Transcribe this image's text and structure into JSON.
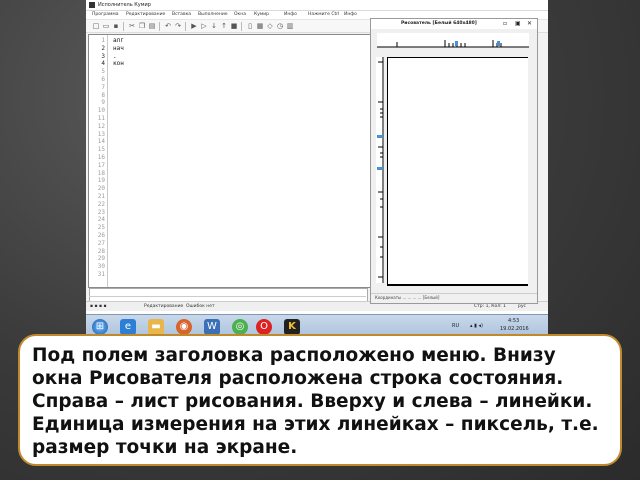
{
  "app": {
    "title": "Исполнитель Кумир",
    "menu": [
      "Программа",
      "Редактирование",
      "Вставка",
      "Выполнение",
      "Окна",
      "Кумир",
      "Инфо",
      "Нажмите Ctrl",
      "Инфо"
    ]
  },
  "editor": {
    "line_numbers": [
      "1",
      "2",
      "3",
      "4",
      "5",
      "6",
      "7",
      "8",
      "9",
      "10",
      "11",
      "12",
      "13",
      "14",
      "15",
      "16",
      "17",
      "18",
      "19",
      "20",
      "21",
      "22",
      "23",
      "24",
      "25",
      "26",
      "27",
      "28",
      "29",
      "30",
      "31"
    ],
    "active_lines": [
      "2",
      "3",
      "4"
    ],
    "code_lines": [
      "алг",
      "нач",
      " .",
      "кон"
    ]
  },
  "statusbar": {
    "mode": "Редактирование",
    "errors": "Ошибок нет",
    "position": "Стр: 1, Кол: 1",
    "lang": "рус"
  },
  "drawer": {
    "title": "Рисователь [Белый 640x480]",
    "status": "Координаты ... ... ... ... [Белый]"
  },
  "taskbar": {
    "tray_lang": "RU",
    "time": "4:53",
    "date": "19.02.2016"
  },
  "caption": {
    "text": "Под полем заголовка расположено меню. Внизу окна Рисователя расположена строка состояния. Справа – лист рисования. Вверху и слева – линейки. Единица измерения на этих линейках – пиксель, т.е. размер точки на экране."
  },
  "colors": {
    "caption_border": "#c08a2c",
    "taskbar": "#b5cbe2"
  }
}
